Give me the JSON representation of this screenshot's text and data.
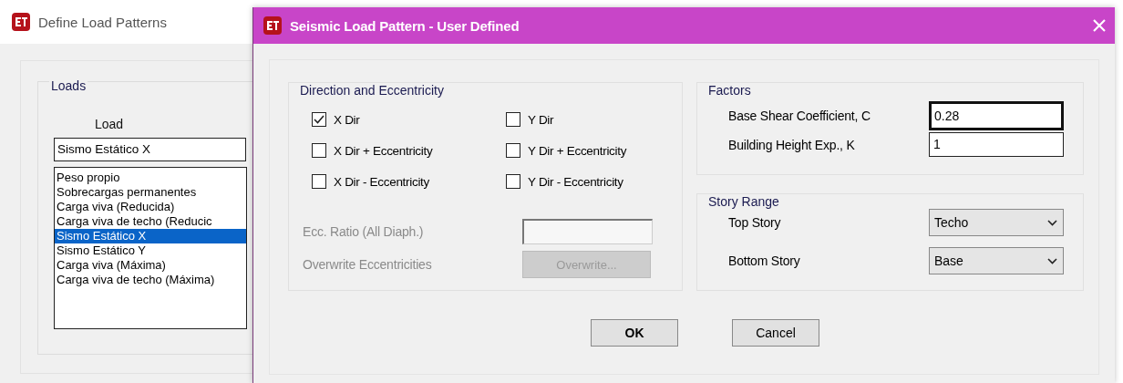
{
  "back_window": {
    "title": "Define Load Patterns",
    "loads_group": {
      "title": "Loads",
      "column_header": "Load",
      "load_field": {
        "value": "Sismo Estático X"
      },
      "load_list": [
        {
          "label": "Peso propio",
          "selected": false
        },
        {
          "label": "Sobrecargas permanentes",
          "selected": false
        },
        {
          "label": "Carga viva (Reducida)",
          "selected": false
        },
        {
          "label": "Carga viva de techo (Reducic",
          "selected": false
        },
        {
          "label": "Sismo Estático X",
          "selected": true
        },
        {
          "label": "Sismo Estático Y",
          "selected": false
        },
        {
          "label": "Carga viva (Máxima)",
          "selected": false
        },
        {
          "label": "Carga viva de techo (Máxima)",
          "selected": false
        }
      ]
    }
  },
  "dialog": {
    "title": "Seismic Load Pattern - User Defined",
    "direction_group": {
      "title": "Direction and Eccentricity",
      "options": [
        {
          "label": "X Dir",
          "checked": true
        },
        {
          "label": "Y Dir",
          "checked": false
        },
        {
          "label": "X Dir + Eccentricity",
          "checked": false
        },
        {
          "label": "Y Dir + Eccentricity",
          "checked": false
        },
        {
          "label": "X Dir - Eccentricity",
          "checked": false
        },
        {
          "label": "Y Dir - Eccentricity",
          "checked": false
        }
      ],
      "ecc_ratio": {
        "label": "Ecc. Ratio (All Diaph.)",
        "disabled": true
      },
      "overwrite": {
        "label": "Overwrite Eccentricities",
        "button": "Overwrite...",
        "disabled": true
      }
    },
    "factors": {
      "title": "Factors",
      "fields": [
        {
          "label": "Base Shear Coefficient, C",
          "value": "0.28",
          "focused": true
        },
        {
          "label": "Building Height Exp., K",
          "value": "1",
          "focused": false
        }
      ]
    },
    "story_range": {
      "title": "Story Range",
      "fields": [
        {
          "label": "Top Story",
          "value": "Techo"
        },
        {
          "label": "Bottom Story",
          "value": "Base"
        }
      ]
    },
    "buttons": [
      "OK",
      "Cancel"
    ]
  }
}
